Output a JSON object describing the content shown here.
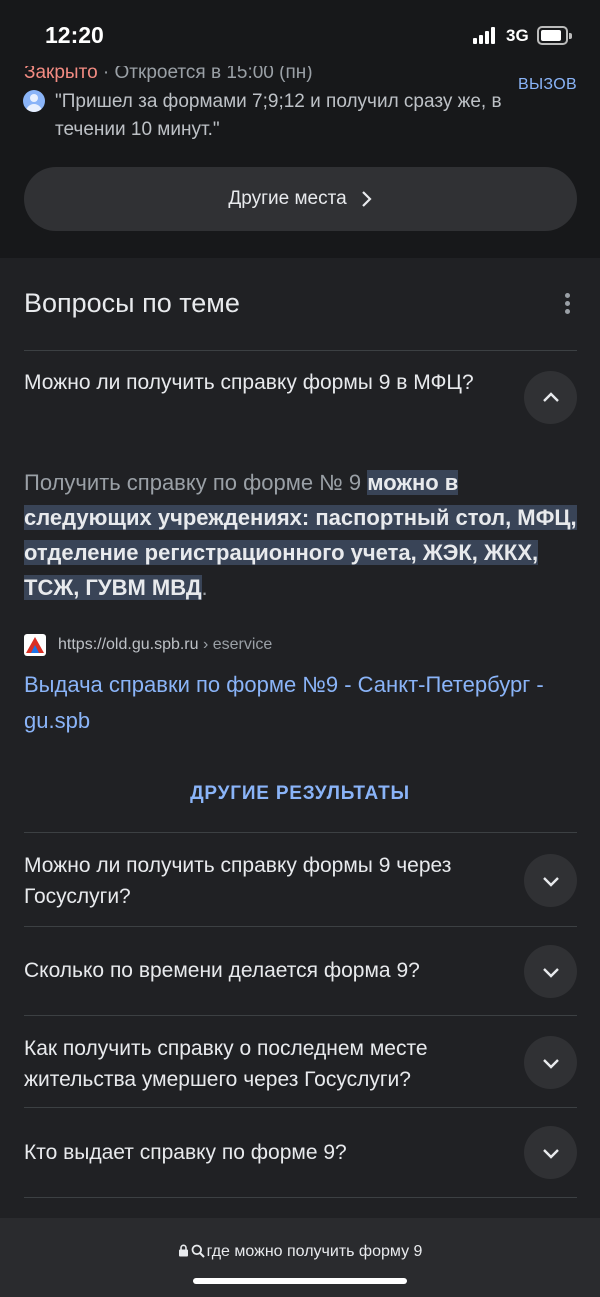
{
  "status_bar": {
    "time": "12:20",
    "network": "3G"
  },
  "place_card": {
    "closed": "Закрыто",
    "opens": " · Откроется в 15:00 (пн)",
    "call_label": "ВЫЗОВ",
    "review": "\"Пришел за формами 7;9;12 и получил сразу же, в течении 10 минут.\"",
    "other_places_label": "Другие места"
  },
  "paa": {
    "title": "Вопросы по теме",
    "expanded": {
      "question": "Можно ли получить справку формы 9 в МФЦ?",
      "answer_plain": "Получить справку по форме № 9 ",
      "answer_highlight": "можно в следующих учреждениях: паспортный стол, МФЦ, отделение регистрационного учета, ЖЭК, ЖКХ, ТСЖ, ГУВМ МВД",
      "answer_end": ".",
      "source_domain": "https://old.gu.spb.ru",
      "source_crumb": " › eservice",
      "result_title": "Выдача справки по форме №9 - Санкт-Петербург - gu.spb"
    },
    "more_results": "ДРУГИЕ РЕЗУЛЬТАТЫ",
    "questions": [
      {
        "text": "Можно ли получить справку формы 9 через Госуслуги?"
      },
      {
        "text": "Сколько по времени делается форма 9?"
      },
      {
        "text": "Как получить справку о последнем месте жительства умершего через Госуслуги?"
      },
      {
        "text": "Кто выдает справку по форме 9?"
      }
    ]
  },
  "browser": {
    "address": "где можно получить форму 9"
  }
}
